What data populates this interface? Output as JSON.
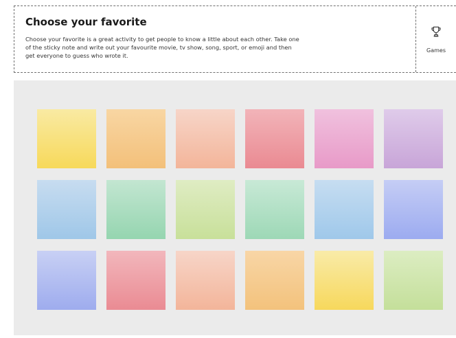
{
  "header": {
    "title": "Choose your favorite",
    "description": "Choose your favorite is a great activity to get people to know a little about each other. Take one of the sticky note and write out your favourite movie, tv show, song, sport, or emoji and then get everyone to guess who wrote it.",
    "games_label": "Games",
    "games_icon": "trophy-icon"
  },
  "board": {
    "background": "#ebebeb",
    "notes": [
      {
        "top": "#f9eaa3",
        "bottom": "#f7d95a"
      },
      {
        "top": "#f8d6a3",
        "bottom": "#f3c07a"
      },
      {
        "top": "#f7d5c8",
        "bottom": "#f3b59a"
      },
      {
        "top": "#f2b4b9",
        "bottom": "#ea8a92"
      },
      {
        "top": "#f0c1de",
        "bottom": "#e89ac8"
      },
      {
        "top": "#dfcbea",
        "bottom": "#c8a5d8"
      },
      {
        "top": "#c7dcf0",
        "bottom": "#9fc7e8"
      },
      {
        "top": "#c3e6d1",
        "bottom": "#95d5b0"
      },
      {
        "top": "#dfecc3",
        "bottom": "#c8e09a"
      },
      {
        "top": "#c8e9d6",
        "bottom": "#9dd8b6"
      },
      {
        "top": "#c6ddf1",
        "bottom": "#9fc8ea"
      },
      {
        "top": "#c5cdf5",
        "bottom": "#9cabf0"
      },
      {
        "top": "#c8d0f4",
        "bottom": "#9eacee"
      },
      {
        "top": "#f2b7bc",
        "bottom": "#ea8b93"
      },
      {
        "top": "#f7d5c8",
        "bottom": "#f3b59a"
      },
      {
        "top": "#f8d6a6",
        "bottom": "#f3c27c"
      },
      {
        "top": "#f9eba8",
        "bottom": "#f7d85c"
      },
      {
        "top": "#dcedc2",
        "bottom": "#c4df9a"
      }
    ]
  }
}
